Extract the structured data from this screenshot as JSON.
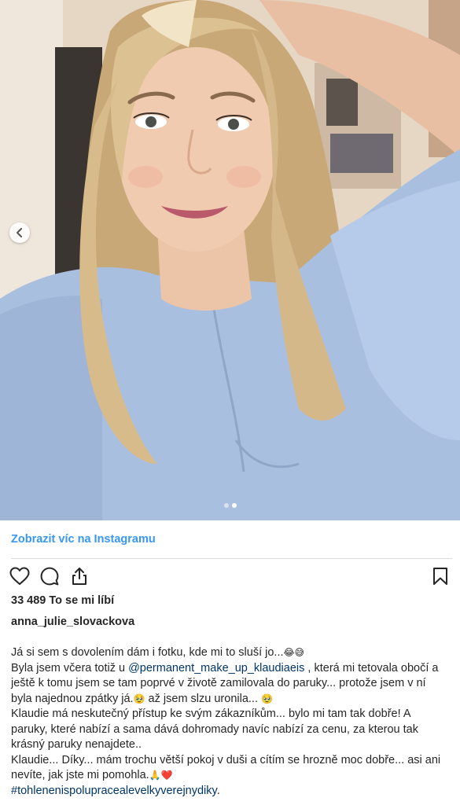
{
  "photo": {
    "description_icon": "selfie-photo",
    "carousel": {
      "total": 2,
      "active_index": 1
    }
  },
  "view_more_label": "Zobrazit víc na Instagramu",
  "likes_text": "33 489 To se mi líbí",
  "username": "anna_julie_slovackova",
  "caption": {
    "line1": "Já si sem s dovolením dám i fotku, kde mi to sluší jo...",
    "line1_emoji": "😂😅",
    "line2_pre": "Byla jsem včera totiž u ",
    "mention": "@permanent_make_up_klaudiaeis",
    "line2_post": " , která mi tetovala obočí a ještě k tomu jsem se tam poprvé v životě zamilovala do paruky... protože jsem v ní byla najednou zpátky já.",
    "emoji_a": "🥹",
    "line2_tail": " až jsem slzu uronila... ",
    "emoji_b": "🥹",
    "line3": "Klaudie má neskutečný přístup ke svým zákazníkům... bylo mi tam tak dobře! A paruky, které nabízí a sama dává dohromady navíc nabízí za cenu, za kterou tak krásný paruky nenajdete..",
    "line4": "Klaudie... Díky... mám trochu větší pokoj v duši a cítím se hrozně moc dobře... asi ani nevíte, jak jste mi pomohla.",
    "line4_emoji": "🙏❤️",
    "hashtag": "#tohlenenispolupracealevelkyverejnydiky",
    "hashtag_tail": "."
  },
  "icons": {
    "like": "heart-icon",
    "comment": "comment-icon",
    "share": "share-icon",
    "save": "bookmark-icon",
    "prev": "chevron-left-icon"
  },
  "colors": {
    "link_blue": "#3897f0",
    "text": "#262626",
    "mention": "#003569",
    "top_blouse": "#a9bfe0"
  }
}
